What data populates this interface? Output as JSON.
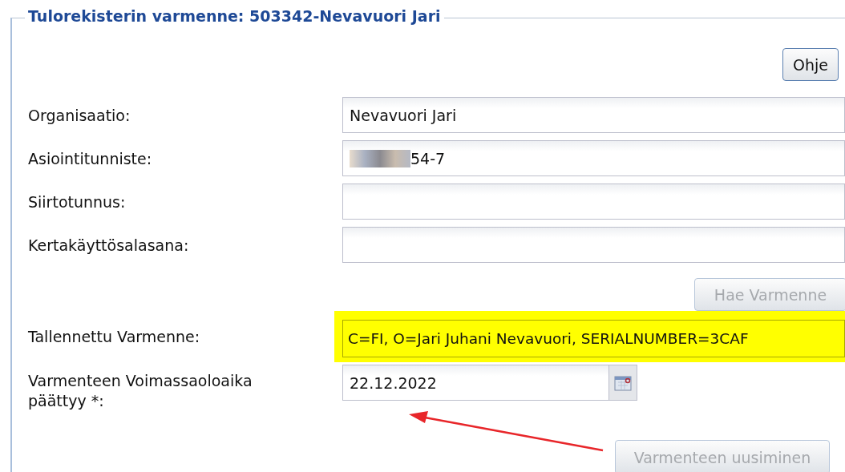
{
  "fieldset": {
    "legend": "Tulorekisterin varmenne: 503342-Nevavuori Jari"
  },
  "help_button": {
    "label": "Ohje",
    "disabled": false
  },
  "fields": [
    {
      "label": "Organisaatio:",
      "value": "Nevavuori Jari",
      "redacted": false
    },
    {
      "label": "Asiointitunniste:",
      "value": "54-7",
      "redacted": true
    },
    {
      "label": "Siirtotunnus:",
      "redacted": false
    },
    {
      "label": "Kertakäyttösalasana:",
      "redacted": false
    }
  ],
  "fetch_button": {
    "label": "Hae Varmenne",
    "disabled": true
  },
  "saved_certificate": {
    "label": "Tallennettu Varmenne:",
    "value": "C=FI, O=Jari Juhani Nevavuori, SERIALNUMBER=3CAF",
    "highlighted": true
  },
  "expiry": {
    "label": "Varmenteen Voimassaoloaika päättyy *:",
    "value": "22.12.2022"
  },
  "renew_button": {
    "label": "Varmenteen uusiminen",
    "disabled": true
  }
}
